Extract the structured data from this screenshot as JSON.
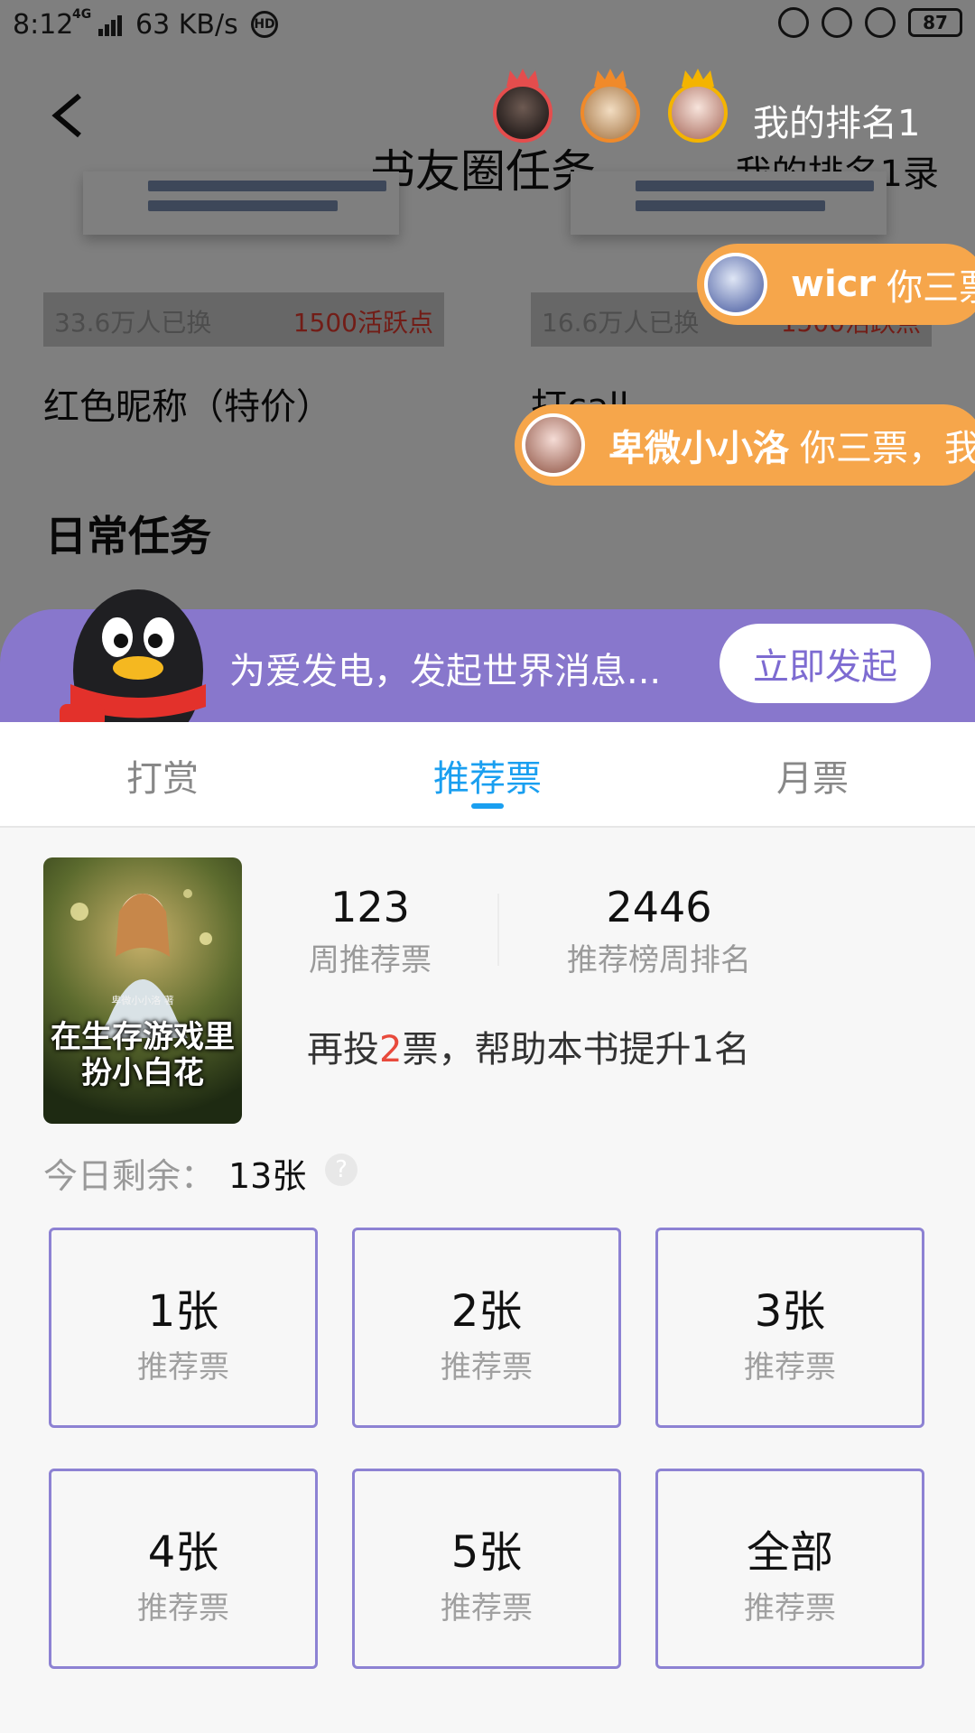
{
  "status_bar": {
    "time": "8:12",
    "network": "4G",
    "speed": "63 KB/s",
    "hd": "HD",
    "battery": "87"
  },
  "header": {
    "title": "书友圈任务",
    "right_link": "我的排名1录"
  },
  "rewards": [
    {
      "count": "33.6万人已换",
      "price": "1500活跃点",
      "name": "红色昵称（特价）"
    },
    {
      "count": "16.6万人已换",
      "price": "1500活跃点",
      "name": "打call"
    }
  ],
  "section_title": "日常任务",
  "ranking": {
    "label": "我的排名1",
    "crown_colors": [
      "#e54d4d",
      "#f08a2a",
      "#f4b400"
    ]
  },
  "danmaku": [
    {
      "name": "wicr",
      "message": "你三票，我"
    },
    {
      "name": "卑微小小洛",
      "message": "你三票，我"
    }
  ],
  "banner": {
    "text": "为爱发电，发起世界消息...",
    "button": "立即发起"
  },
  "tabs": [
    {
      "label": "打赏",
      "active": false
    },
    {
      "label": "推荐票",
      "active": true
    },
    {
      "label": "月票",
      "active": false
    }
  ],
  "book": {
    "title_line1": "在生存游戏里",
    "title_line2": "扮小白花",
    "author": "卑微小小洛 著"
  },
  "stats": [
    {
      "value": "123",
      "label": "周推荐票"
    },
    {
      "value": "2446",
      "label": "推荐榜周排名"
    }
  ],
  "hint": {
    "prefix": "再投",
    "highlight": "2",
    "suffix": "票，帮助本书提升1名"
  },
  "remaining": {
    "label": "今日剩余：",
    "value": "13张"
  },
  "vote_options": [
    {
      "count": "1张",
      "unit": "推荐票"
    },
    {
      "count": "2张",
      "unit": "推荐票"
    },
    {
      "count": "3张",
      "unit": "推荐票"
    },
    {
      "count": "4张",
      "unit": "推荐票"
    },
    {
      "count": "5张",
      "unit": "推荐票"
    },
    {
      "count": "全部",
      "unit": "推荐票"
    }
  ],
  "colors": {
    "accent_blue": "#1a9ff0",
    "banner_purple": "#8877cc",
    "danmaku_orange": "#f6a64b",
    "hint_red": "#e84a3c",
    "vote_border": "#8d82d3"
  }
}
